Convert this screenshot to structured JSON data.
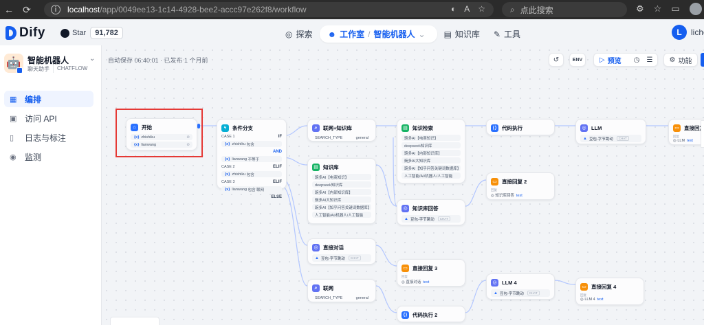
{
  "browser": {
    "url_host": "localhost",
    "url_path": "/app/0049ee13-1c14-4928-bee2-accc97e262f8/workflow",
    "search_placeholder": "点此搜索"
  },
  "header": {
    "logo": "Dify",
    "github_label": "Star",
    "github_count": "91,782",
    "nav": {
      "explore": "探索",
      "studio": "工作室",
      "current_app": "智能机器人",
      "knowledge": "知识库",
      "tools": "工具"
    },
    "user_initial": "L",
    "user_name": "liche"
  },
  "sidebar": {
    "app_name": "智能机器人",
    "app_type": "聊天助手",
    "app_mode": "CHATFLOW",
    "items": [
      {
        "label": "编排",
        "icon": "layout-icon"
      },
      {
        "label": "访问 API",
        "icon": "terminal-icon"
      },
      {
        "label": "日志与标注",
        "icon": "file-icon"
      },
      {
        "label": "监测",
        "icon": "monitor-icon"
      }
    ]
  },
  "toolbar": {
    "autosave": "自动保存 06:40:01 · 已发布 1 个月前",
    "env": "ENV",
    "preview": "预览",
    "features": "功能"
  },
  "nodes": {
    "start": {
      "title": "开始",
      "vars": [
        "zhishiku",
        "lianwang"
      ]
    },
    "branch": {
      "title": "条件分支",
      "case1": "CASE 1",
      "if": "IF",
      "and": "AND",
      "c1a_var": "zhishiku",
      "c1a_op": "包含",
      "c1b_var": "lianwang",
      "c1b_op": "不等于",
      "case2": "CASE 2",
      "elif1": "ELIF",
      "c2_var": "zhishiku",
      "c2_op": "包含",
      "case3": "CASE 3",
      "elif2": "ELIF",
      "c3_var": "lianwang",
      "c3_op": "包含 联网",
      "else": "ELSE"
    },
    "web_kb": {
      "title": "联网+知识库",
      "key": "SEARCH_TYPE",
      "value": "general"
    },
    "kb_retrieval": {
      "title": "知识检索",
      "items": [
        "豌多AI【电商知识】",
        "deepseek知识库",
        "豌多AI【内部知识库】",
        "豌多AI大知识库",
        "豌多AI【知乎问答关键词数据库】",
        "人工智能/AI/机器人/人工智能"
      ]
    },
    "code1": {
      "title": "代码执行"
    },
    "llm": {
      "title": "LLM",
      "model": "豆包-字节跳动",
      "mode": "CHAT"
    },
    "answer": {
      "title": "直接回复",
      "out_label": "回复",
      "out_ref": "LLM",
      "out_field": "text"
    },
    "kb": {
      "title": "知识库",
      "items": [
        "豌多AI【电商知识】",
        "deepseek知识库",
        "豌多AI【内部知识库】",
        "豌多AI大知识库",
        "豌多AI【知乎问答关键词数据库】",
        "人工智能/AI/机器人/人工智能"
      ]
    },
    "answer2": {
      "title": "直接回复 2",
      "out_label": "回复",
      "out_ref": "知识库回答",
      "out_field": "text"
    },
    "kb_answer": {
      "title": "知识库回答",
      "model": "豆包-字节跳动",
      "mode": "CHAT"
    },
    "direct_chat": {
      "title": "直接对话",
      "model": "豆包-字节跳动",
      "mode": "CHAT"
    },
    "answer3": {
      "title": "直接回复 3",
      "out_label": "回复",
      "out_ref": "直接对话",
      "out_field": "text"
    },
    "web": {
      "title": "联网",
      "key": "SEARCH_TYPE",
      "value": "general"
    },
    "llm4": {
      "title": "LLM 4",
      "model": "豆包-字节跳动",
      "mode": "CHAT"
    },
    "answer4": {
      "title": "直接回复 4",
      "out_label": "回复",
      "out_ref": "LLM 4",
      "out_field": "text"
    },
    "code2": {
      "title": "代码执行 2"
    }
  }
}
